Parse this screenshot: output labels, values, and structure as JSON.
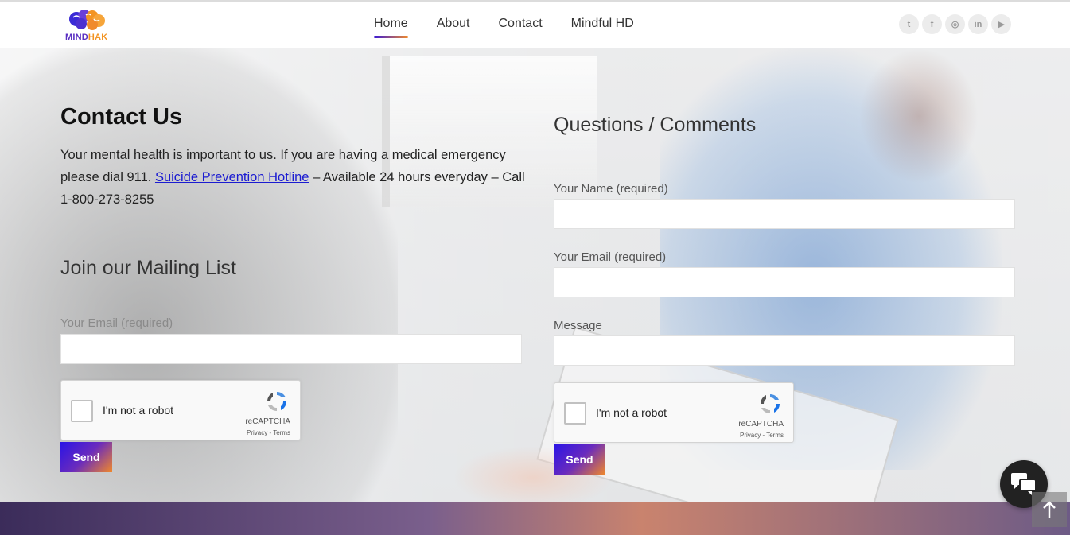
{
  "brand": {
    "name_a": "MIND",
    "name_b": "HAK"
  },
  "nav": [
    {
      "label": "Home",
      "active": true
    },
    {
      "label": "About"
    },
    {
      "label": "Contact"
    },
    {
      "label": "Mindful HD"
    }
  ],
  "social": [
    {
      "icon": "twitter-icon",
      "glyph": "t"
    },
    {
      "icon": "facebook-icon",
      "glyph": "f"
    },
    {
      "icon": "instagram-icon",
      "glyph": "◎"
    },
    {
      "icon": "linkedin-icon",
      "glyph": "in"
    },
    {
      "icon": "youtube-icon",
      "glyph": "▶"
    }
  ],
  "contact": {
    "title": "Contact Us",
    "intro_1": "Your mental health is important to us. If you are having a medical emergency please dial 911. ",
    "hotline_link": "Suicide Prevention Hotline",
    "intro_2": " – Available 24 hours everyday –  Call 1-800-273-8255"
  },
  "mailing": {
    "title": "Join our Mailing List",
    "email_label": "Your Email (required)",
    "email_value": "",
    "send_label": "Send"
  },
  "questions": {
    "title": "Questions / Comments",
    "name_label": "Your Name (required)",
    "name_value": "",
    "email_label": "Your Email (required)",
    "email_value": "",
    "message_label": "Message",
    "message_value": "",
    "send_label": "Send"
  },
  "captcha": {
    "text": "I'm not a robot",
    "brand": "reCAPTCHA",
    "links": "Privacy - Terms"
  },
  "colors": {
    "accent_start": "#2a14e6",
    "accent_end": "#f0882a",
    "link": "#1b1bd1"
  }
}
